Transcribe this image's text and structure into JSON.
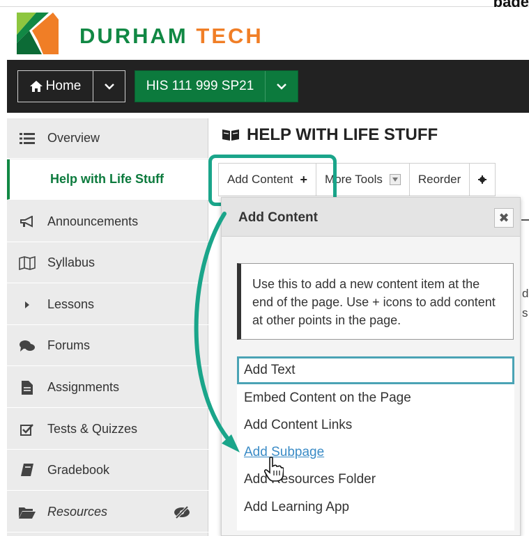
{
  "top_strip": {
    "cut_text": "page"
  },
  "brand": {
    "logo_primary": "DURHAM",
    "logo_secondary": "TECH",
    "colors": {
      "green": "#118844",
      "orange": "#f07e26"
    }
  },
  "topnav": {
    "home_label": "Home",
    "home_icon": "home-icon",
    "site_label": "HIS 111 999 SP21"
  },
  "sidebar": {
    "items": [
      {
        "label": "Overview",
        "icon": "list-icon"
      },
      {
        "label": "Help with Life Stuff",
        "icon": "",
        "active": true
      },
      {
        "label": "Announcements",
        "icon": "megaphone-icon"
      },
      {
        "label": "Syllabus",
        "icon": "map-icon"
      },
      {
        "label": "Lessons",
        "icon": "caret-right-icon"
      },
      {
        "label": "Forums",
        "icon": "chat-bubbles-icon"
      },
      {
        "label": "Assignments",
        "icon": "document-icon"
      },
      {
        "label": "Tests & Quizzes",
        "icon": "checkbox-icon"
      },
      {
        "label": "Gradebook",
        "icon": "book-icon"
      },
      {
        "label": "Resources",
        "icon": "folder-open-icon",
        "hidden_toggle_icon": "eye-slash-icon"
      }
    ]
  },
  "main": {
    "page_title": "HELP WITH LIFE STUFF",
    "toolbar": {
      "add_content": "Add Content",
      "more_tools": "More Tools",
      "reorder": "Reorder"
    },
    "edge_text": {
      "line1": "d",
      "line2": "s"
    }
  },
  "dropdown": {
    "title": "Add Content",
    "close": "✖",
    "info": "Use this to add a new content item at the end of the page. Use + icons to add content at other points in the page.",
    "options": [
      "Add Text",
      "Embed Content on the Page",
      "Add Content Links",
      "Add Subpage",
      "Add Resources Folder",
      "Add Learning App"
    ]
  },
  "annotation": {
    "color": "#1aa58a"
  }
}
